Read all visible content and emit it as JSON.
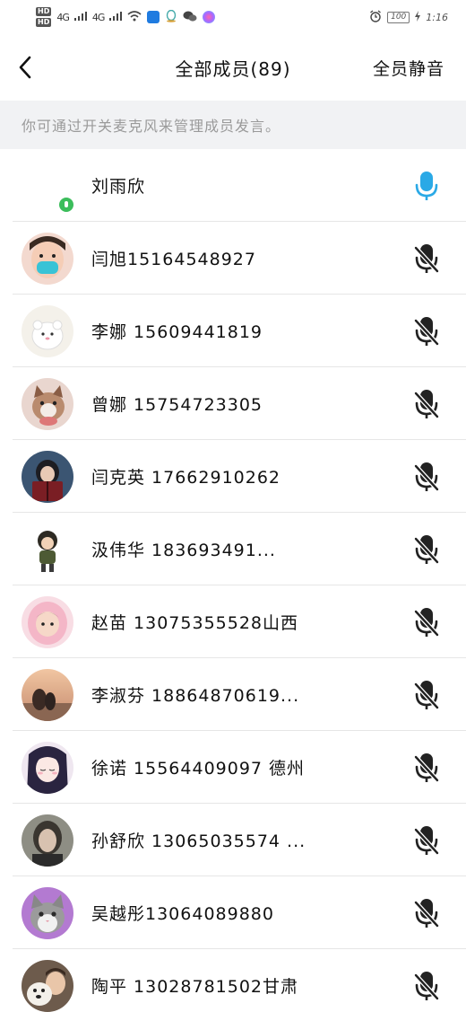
{
  "status_bar": {
    "hd1": "HD",
    "hd2": "HD",
    "net1": "4G",
    "net2": "4G",
    "battery": "100",
    "time": "1:16"
  },
  "nav": {
    "title": "全部成员(89)",
    "mute_all": "全员静音"
  },
  "hint": "你可通过开关麦克风来管理成员发言。",
  "colors": {
    "mic_active": "#2aa9e6",
    "mic_muted": "#222222",
    "speaking_dot": "#3bbd5b"
  },
  "members": [
    {
      "name": "刘雨欣",
      "avatar": "none",
      "mic": "on",
      "speaking": true
    },
    {
      "name": "闫旭15164548927",
      "avatar": "baby-mask",
      "mic": "off"
    },
    {
      "name": "李娜 15609441819",
      "avatar": "white-bear",
      "mic": "off"
    },
    {
      "name": "曾娜 15754723305",
      "avatar": "kitten",
      "mic": "off"
    },
    {
      "name": "闫克英 17662910262",
      "avatar": "girl-book",
      "mic": "off"
    },
    {
      "name": "汲伟华       183693491...",
      "avatar": "cartoon-boy",
      "mic": "off"
    },
    {
      "name": "赵苗 13075355528山西",
      "avatar": "toddler-pink",
      "mic": "off"
    },
    {
      "name": "李淑芬  18864870619...",
      "avatar": "sunset",
      "mic": "off"
    },
    {
      "name": "徐诺 15564409097 德州",
      "avatar": "anime-girl",
      "mic": "off"
    },
    {
      "name": "孙舒欣 13065035574 ...",
      "avatar": "teen-portrait",
      "mic": "off"
    },
    {
      "name": "吴越彤13064089880",
      "avatar": "grey-cat",
      "mic": "off"
    },
    {
      "name": "陶平 13028781502甘肃",
      "avatar": "boy-dog",
      "mic": "off"
    }
  ]
}
